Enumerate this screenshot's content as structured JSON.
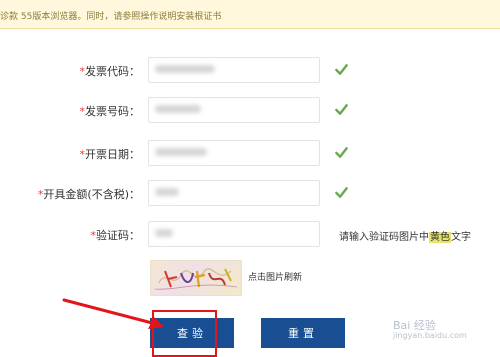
{
  "notice": {
    "text": "诊款 55版本浏览器。同时，请参照操作说明安装根证书"
  },
  "form": {
    "fields": [
      {
        "required": "*",
        "label": "发票代码：",
        "status": "check-icon"
      },
      {
        "required": "*",
        "label": "发票号码：",
        "status": "check-icon"
      },
      {
        "required": "*",
        "label": "开票日期：",
        "status": "check-icon"
      },
      {
        "required": "*",
        "label": "开具金额(不含税)：",
        "status": "check-icon"
      },
      {
        "required": "*",
        "label": "验证码："
      }
    ],
    "captcha_hint": {
      "before": "请输入验证码图片中",
      "highlight": "黄色",
      "after": "文字"
    },
    "captcha_refresh": "点击图片刷新"
  },
  "buttons": {
    "query": "查验",
    "reset": "重置"
  },
  "colors": {
    "accent": "#1a4e93",
    "check": "#6aa84f",
    "annotation": "#e3151b",
    "notice_bg": "#fff8dc"
  },
  "watermark": {
    "brand": "Bai 经验",
    "url": "jingyan.baidu.com"
  }
}
